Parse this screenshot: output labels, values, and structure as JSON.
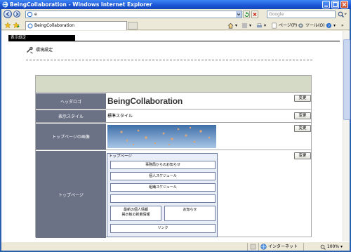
{
  "window": {
    "title": "BeingCollaboration - Windows Internet Explorer"
  },
  "browser": {
    "address_value": "e",
    "search_placeholder": "Google",
    "tab_label": "BeingCollaboration",
    "commands": {
      "page": "ページ(P)",
      "tools": "ツール(O)"
    },
    "status": {
      "zone": "インターネット",
      "zoom": "100%"
    }
  },
  "page": {
    "section_tab": "表示設定",
    "heading": "環境設定",
    "change_label": "変更",
    "rows": {
      "header_logo": {
        "label": "ヘッダロゴ",
        "value": "BeingCollaboration"
      },
      "display_style": {
        "label": "表示スタイル",
        "value": "標準スタイル"
      },
      "top_image": {
        "label": "トップページの画像"
      },
      "top_page": {
        "label": "トップページ",
        "portal_title": "トップページ",
        "items": {
          "office_notice": "事務局からのお知らせ",
          "personal_schedule": "個人スケジュール",
          "org_schedule": "組織スケジュール",
          "blank": "",
          "personal_info": "最新の個人情報",
          "board_info": "掲示板の新着情報",
          "notice": "お知らせ",
          "link": "リンク"
        }
      }
    }
  },
  "colors": {
    "titlebar": "#1a55d6",
    "label_bg": "#6b7286",
    "panel_header": "#d4dac6",
    "portal_bg": "#e8edf7"
  }
}
